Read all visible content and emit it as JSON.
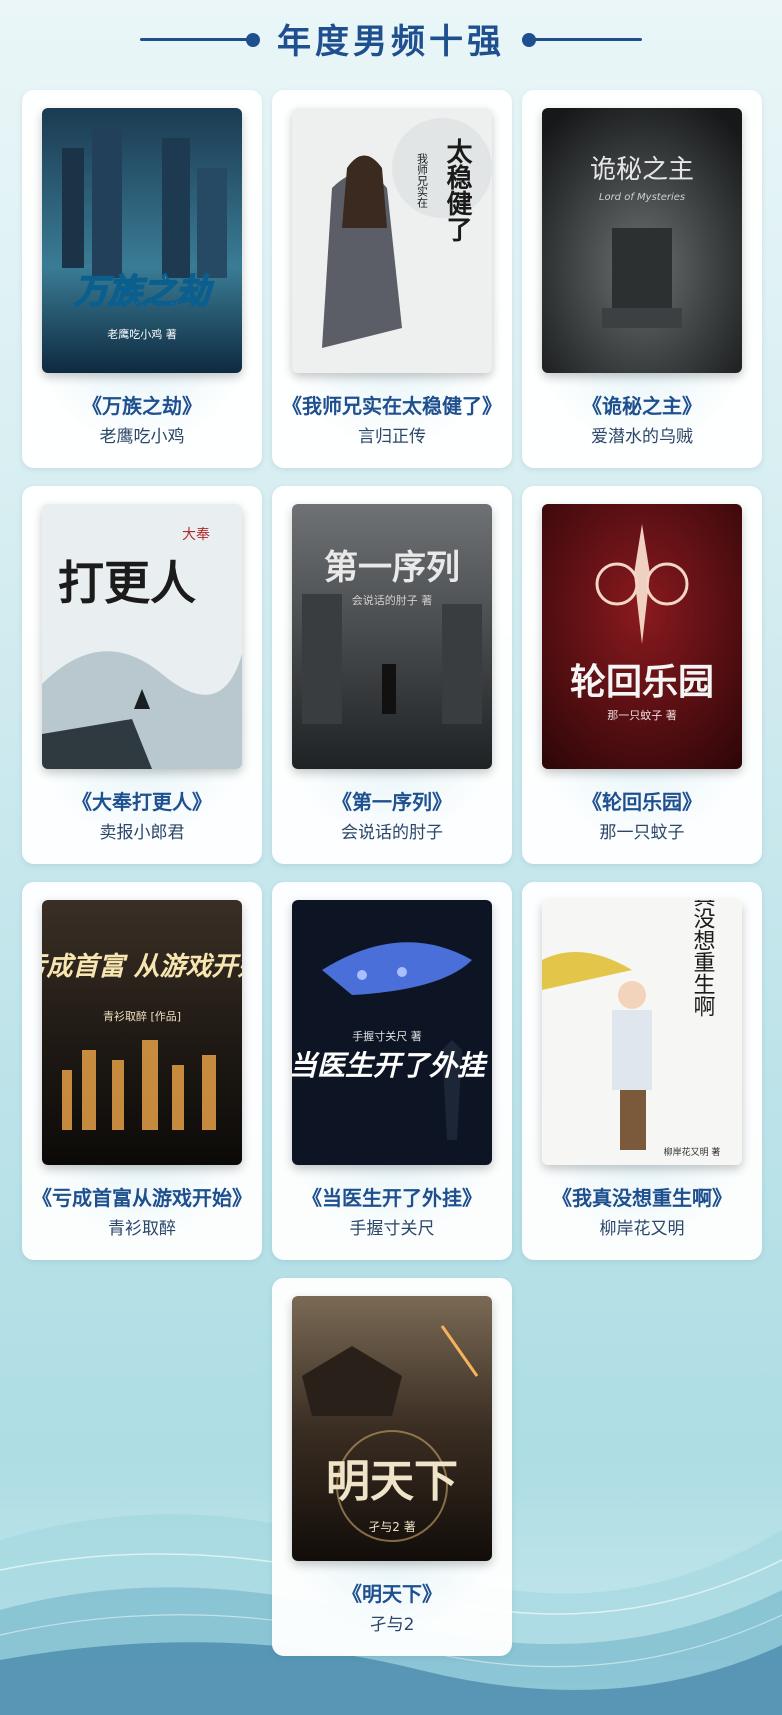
{
  "header": {
    "title": "年度男频十强"
  },
  "books": [
    {
      "title": "《万族之劫》",
      "author": "老鹰吃小鸡",
      "cover_text": "万族之劫",
      "cover_sub": "老鹰吃小鸡 著"
    },
    {
      "title": "《我师兄实在太稳健了》",
      "author": "言归正传",
      "cover_text": "太稳健了",
      "cover_sub": "我师兄实在"
    },
    {
      "title": "《诡秘之主》",
      "author": "爱潜水的乌贼",
      "cover_text": "诡秘之主",
      "cover_sub": "Lord of Mysteries"
    },
    {
      "title": "《大奉打更人》",
      "author": "卖报小郎君",
      "cover_text": "打更人",
      "cover_sub": "大奉"
    },
    {
      "title": "《第一序列》",
      "author": "会说话的肘子",
      "cover_text": "第一序列",
      "cover_sub": "会说话的肘子 著"
    },
    {
      "title": "《轮回乐园》",
      "author": "那一只蚊子",
      "cover_text": "轮回乐园",
      "cover_sub": "那一只蚊子 著"
    },
    {
      "title": "《亏成首富从游戏开始》",
      "author": "青衫取醉",
      "cover_text": "亏成首富 从游戏开始",
      "cover_sub": "青衫取醉 [作品]"
    },
    {
      "title": "《当医生开了外挂》",
      "author": "手握寸关尺",
      "cover_text": "当医生开了外挂",
      "cover_sub": "手握寸关尺 著"
    },
    {
      "title": "《我真没想重生啊》",
      "author": "柳岸花又明",
      "cover_text": "我真没想重生啊",
      "cover_sub": "柳岸花又明 著"
    },
    {
      "title": "《明天下》",
      "author": "孑与2",
      "cover_text": "明天下",
      "cover_sub": "孑与2 著"
    }
  ]
}
